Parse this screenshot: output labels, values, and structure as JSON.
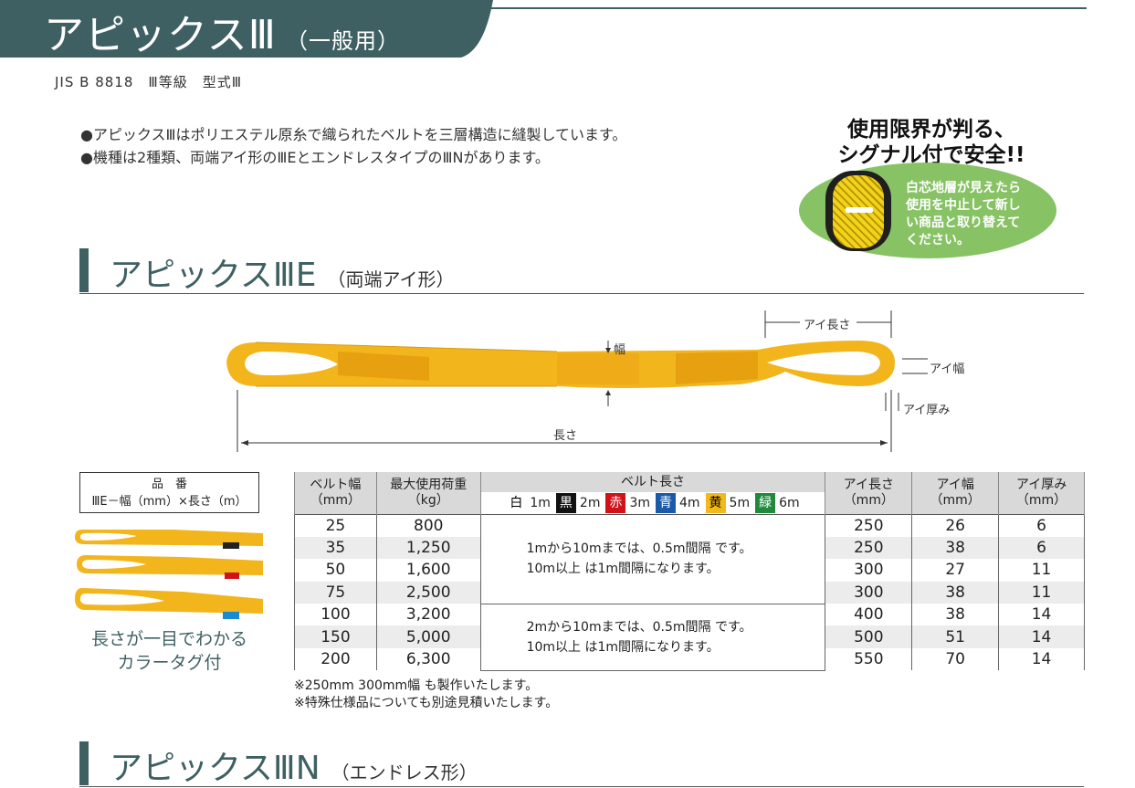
{
  "header": {
    "title": "アピックスⅢ",
    "subtitle": "（一般用）",
    "jis": "JIS B 8818　Ⅲ等級　型式Ⅲ",
    "band_color": "#3f6063"
  },
  "bullets": [
    "●アピックスⅢはポリエステル原糸で織られたベルトを三層構造に縫製しています。",
    "●機種は2種類、両端アイ形のⅢEとエンドレスタイプのⅢNがあります。"
  ],
  "badge": {
    "headline_1": "使用限界が判る、",
    "headline_2": "シグナル付で安全!!",
    "text_1": "白芯地層が見えたら",
    "text_2": "使用を中止して新し",
    "text_3": "い商品と取り替えて",
    "text_4": "ください。",
    "bg_color": "#87c264"
  },
  "section_e": {
    "title": "アピックスⅢE",
    "subtitle": "（両端アイ形）"
  },
  "section_n": {
    "title": "アピックスⅢN",
    "subtitle": "（エンドレス形）"
  },
  "diagram": {
    "eye_length": "アイ長さ",
    "width": "幅",
    "eye_width": "アイ幅",
    "eye_thickness": "アイ厚み",
    "length": "長さ",
    "sling_color": "#f2b51c"
  },
  "part_number": {
    "title": "品　番",
    "format": "ⅢE－幅（mm）×長さ（m）"
  },
  "tag_caption": {
    "line1": "長さが一目でわかる",
    "line2": "カラータグ付"
  },
  "table": {
    "headers": {
      "belt_width": "ベルト幅",
      "belt_width_unit": "（mm）",
      "max_load": "最大使用荷重",
      "max_load_unit": "（kg）",
      "belt_length": "ベルト長さ",
      "eye_length": "アイ長さ",
      "eye_length_unit": "（mm）",
      "eye_width": "アイ幅",
      "eye_width_unit": "（mm）",
      "eye_thickness": "アイ厚み",
      "eye_thickness_unit": "（mm）"
    },
    "colors": [
      {
        "swatch": "白",
        "length": "1m",
        "bg": "#ffffff",
        "fg": "#000000"
      },
      {
        "swatch": "黒",
        "length": "2m",
        "bg": "#111111",
        "fg": "#ffffff"
      },
      {
        "swatch": "赤",
        "length": "3m",
        "bg": "#d0121b",
        "fg": "#ffffff"
      },
      {
        "swatch": "青",
        "length": "4m",
        "bg": "#1a5aa8",
        "fg": "#ffffff"
      },
      {
        "swatch": "黄",
        "length": "5m",
        "bg": "#f3b81a",
        "fg": "#000000"
      },
      {
        "swatch": "緑",
        "length": "6m",
        "bg": "#1f8a3c",
        "fg": "#ffffff"
      }
    ],
    "rows": [
      {
        "width": "25",
        "load": "800",
        "eye_length": "250",
        "eye_width": "26",
        "eye_thickness": "6"
      },
      {
        "width": "35",
        "load": "1,250",
        "eye_length": "250",
        "eye_width": "38",
        "eye_thickness": "6"
      },
      {
        "width": "50",
        "load": "1,600",
        "eye_length": "300",
        "eye_width": "27",
        "eye_thickness": "11"
      },
      {
        "width": "75",
        "load": "2,500",
        "eye_length": "300",
        "eye_width": "38",
        "eye_thickness": "11"
      },
      {
        "width": "100",
        "load": "3,200",
        "eye_length": "400",
        "eye_width": "38",
        "eye_thickness": "14"
      },
      {
        "width": "150",
        "load": "5,000",
        "eye_length": "500",
        "eye_width": "51",
        "eye_thickness": "14"
      },
      {
        "width": "200",
        "load": "6,300",
        "eye_length": "550",
        "eye_width": "70",
        "eye_thickness": "14"
      }
    ],
    "note_group1_line1": "1mから10mまでは、0.5m間隔 です。",
    "note_group1_line2": "10m以上 は1m間隔になります。",
    "note_group2_line1": "2mから10mまでは、0.5m間隔 です。",
    "note_group2_line2": "10m以上 は1m間隔になります。"
  },
  "footnotes": [
    "※250mm 300mm幅  も製作いたします。",
    "※特殊仕様品についても別途見積いたします。"
  ]
}
